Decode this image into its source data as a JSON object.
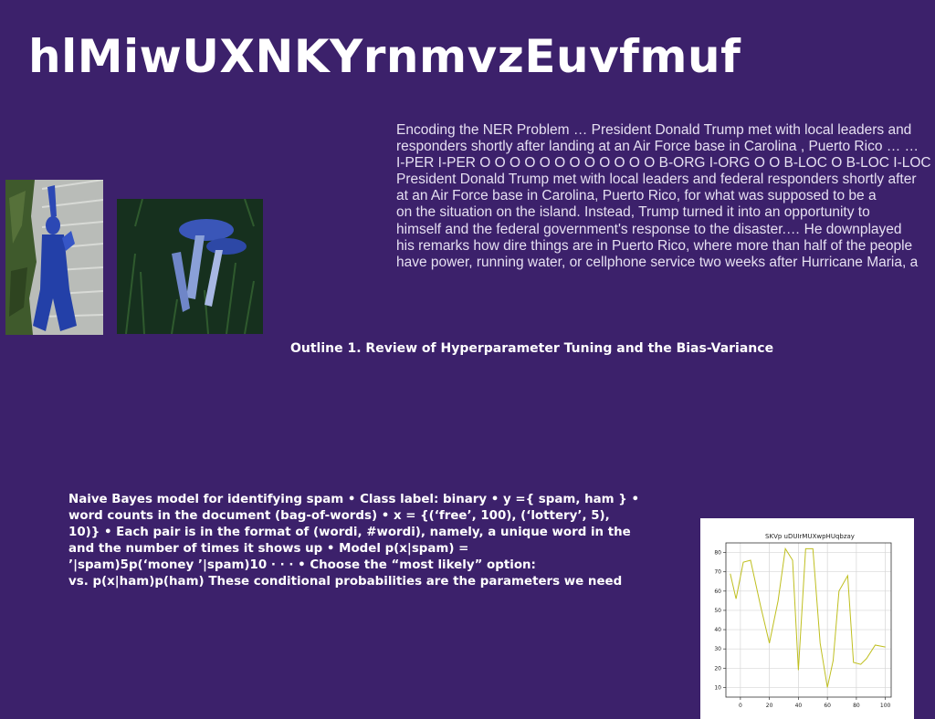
{
  "title": "hlMiwUXNKYrnmvzEuvfmuf",
  "ner_paragraph": [
    "Encoding the NER Problem … President Donald Trump met with local leaders and",
    "responders shortly after landing at an Air Force base in Carolina , Puerto Rico … …",
    "I-PER I-PER O O O O O O O O O O O O B-ORG I-ORG O O B-LOC O B-LOC I-LOC",
    "President Donald Trump met with local leaders and federal responders shortly after",
    "at an Air Force base in Carolina, Puerto Rico, for what was supposed to be a",
    "on the situation on the island. Instead, Trump turned it into an opportunity to",
    "himself and the federal government's response to the disaster.… He downplayed",
    "his remarks how dire things are in Puerto Rico, where more than half of the people",
    "have power, running water, or cellphone service two weeks after Hurricane Maria, a"
  ],
  "outline": "Outline 1. Review of Hyperparameter Tuning and the Bias-Variance",
  "naive_bayes": [
    "Naive Bayes model for identifying spam • Class label: binary • y ={ spam, ham } •",
    "word counts in the document (bag-of-words) • x = {(‘free’, 100), (‘lottery’, 5),",
    "10)} • Each pair is in the format of (wordi, #wordi), namely, a unique word in the",
    "and the number of times it shows up • Model p(x|spam) =",
    "’|spam)5p(‘money ’|spam)10 · · · • Choose the “most likely” option:",
    "vs. p(x|ham)p(ham) These conditional probabilities are the parameters we need"
  ],
  "chart_data": {
    "type": "line",
    "title": "SKVp uDUIrMUXwpHUqbzay",
    "xlabel": "",
    "ylabel": "",
    "x": [
      -7,
      -3,
      2,
      7,
      14,
      20,
      26,
      31,
      36,
      40,
      45,
      50,
      55,
      60,
      64,
      68,
      74,
      78,
      83,
      87,
      93,
      100
    ],
    "series": [
      {
        "values": [
          69,
          56,
          75,
          76,
          52,
          33,
          55,
          82,
          76,
          19,
          82,
          82,
          33,
          10,
          24,
          60,
          68,
          23,
          22,
          25,
          32,
          31
        ]
      }
    ],
    "xlim": [
      -10,
      104
    ],
    "ylim": [
      5,
      85
    ],
    "xticks": [
      0,
      20,
      40,
      60,
      80,
      100
    ],
    "yticks": [
      10,
      20,
      30,
      40,
      50,
      60,
      70,
      80
    ],
    "grid": true,
    "line_color": "#bfbf1f"
  }
}
